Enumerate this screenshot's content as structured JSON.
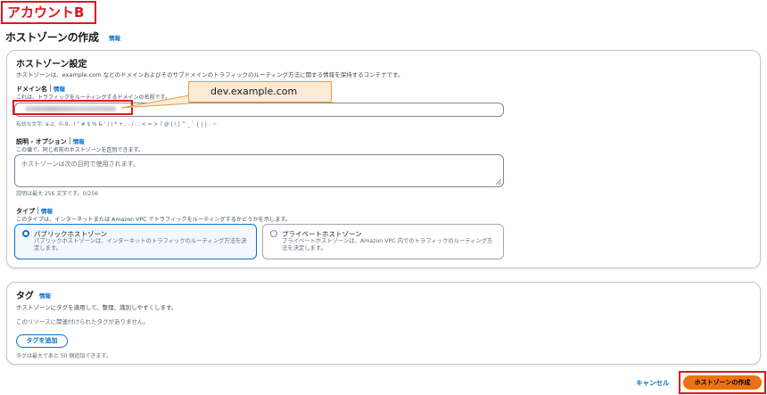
{
  "account_label": "アカウントB",
  "page": {
    "title": "ホストゾーンの作成",
    "info": "情報"
  },
  "settings": {
    "title": "ホストゾーン設定",
    "description": "ホストゾーンは、example.com などのドメインおよびそのサブドメインのトラフィックのルーティング方法に関する情報を保持するコンテナです。",
    "domain": {
      "label": "ドメイン名",
      "info": "情報",
      "description": "これは、トラフィックをルーティングするドメインの名前です。",
      "value": "",
      "hint": "有効な文字: a–z、0–9、! \" # $ % & ' ( ) * + , - / : ; < = > ? @ [ \\ ] ^ _ ` { | } . ~"
    },
    "description_field": {
      "label": "説明 - オプション",
      "info": "情報",
      "description": "この値で、同じ名前のホストゾーンを区別できます。",
      "placeholder": "ホストゾーンは次の目的で使用されます。",
      "hint": "説明は最大 256 文字です。0/256"
    },
    "type": {
      "label": "タイプ",
      "info": "情報",
      "description": "このタイプは、インターネットまたは Amazon VPC でトラフィックをルーティングするかどうかを示します。",
      "options": [
        {
          "title": "パブリックホストゾーン",
          "description": "パブリックホストゾーンは、インターネットのトラフィックのルーティング方法を決定します。",
          "selected": true
        },
        {
          "title": "プライベートホストゾーン",
          "description": "プライベートホストゾーンは、Amazon VPC 内でのトラフィックのルーティング方法を決定します。",
          "selected": false
        }
      ]
    }
  },
  "callout": "dev.example.com",
  "tags": {
    "title": "タグ",
    "info": "情報",
    "description": "ホストゾーンにタグを適用して、整理、識別しやすくします。",
    "empty_text": "このリソースに関連付けられたタグがありません。",
    "add_button": "タグを追加",
    "limit_text": "タグは最大であと 50 個追加できます。"
  },
  "footer": {
    "cancel": "キャンセル",
    "create": "ホストゾーンの作成"
  },
  "colors": {
    "primary": "#ec7211",
    "link": "#0972d3",
    "highlight": "#e4131c",
    "callout_fill": "#fdebd6"
  }
}
